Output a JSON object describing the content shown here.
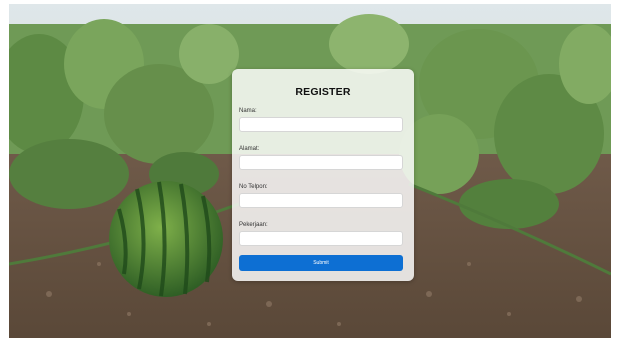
{
  "form": {
    "title": "REGISTER",
    "fields": [
      {
        "label": "Nama:",
        "value": "",
        "placeholder": ""
      },
      {
        "label": "Alamat:",
        "value": "",
        "placeholder": ""
      },
      {
        "label": "No Telpon:",
        "value": "",
        "placeholder": ""
      },
      {
        "label": "Pekerjaan:",
        "value": "",
        "placeholder": ""
      }
    ],
    "submit_label": "Submit"
  },
  "colors": {
    "accent": "#0d6fd3",
    "card_bg": "#ffffff"
  }
}
